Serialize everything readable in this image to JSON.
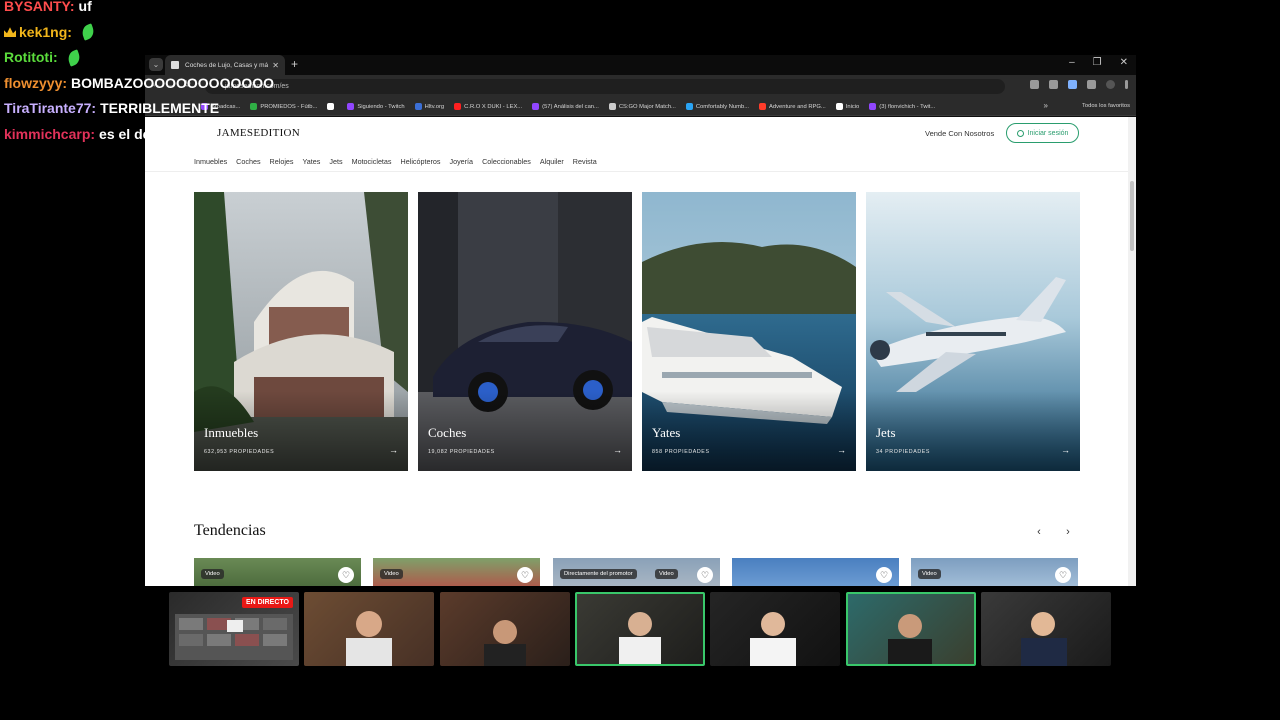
{
  "chat": {
    "messages": [
      {
        "user": "BYSANTY:",
        "text": "uf",
        "color": "#ff4d4d",
        "crown": false,
        "emote": false
      },
      {
        "user": "kek1ng:",
        "text": "",
        "color": "#f2b61b",
        "crown": true,
        "emote": true
      },
      {
        "user": "Rotitoti:",
        "text": "",
        "color": "#5bdc3c",
        "crown": false,
        "emote": true
      },
      {
        "user": "flowzyyy:",
        "text": "BOMBAZOOOOOOOOOOOOO",
        "color": "#f09030",
        "crown": false,
        "emote": false
      },
      {
        "user": "TiraTirante77:",
        "text": "TERRIBLEMENTE",
        "color": "#c8b0ff",
        "crown": false,
        "emote": false
      },
      {
        "user": "kimmichcarp:",
        "text": "es el de john wick",
        "color": "#e2325a",
        "crown": false,
        "emote": false
      }
    ]
  },
  "browser": {
    "tab_title": "Coches de Lujo, Casas y más - J",
    "url": "jamesedition.com/es",
    "bookmarks": [
      {
        "label": "Broadcas...",
        "color": "#9146ff"
      },
      {
        "label": "PROMIEDOS - Fútb...",
        "color": "#2fae45"
      },
      {
        "label": "",
        "color": "#ffffff"
      },
      {
        "label": "Siguiendo - Twitch",
        "color": "#9146ff"
      },
      {
        "label": "Hltv.org",
        "color": "#3b6fd6"
      },
      {
        "label": "C.R.O X DUKI - LEX...",
        "color": "#ff2020"
      },
      {
        "label": "(57) Análisis del can...",
        "color": "#9146ff"
      },
      {
        "label": "CS:GO Major Match...",
        "color": "#cccccc"
      },
      {
        "label": "Comfortably Numb...",
        "color": "#2aa4f4"
      },
      {
        "label": "Adventure and RPG...",
        "color": "#ff3c2a"
      },
      {
        "label": "Inicio",
        "color": "#ffffff"
      },
      {
        "label": "(3) flonvichich - Twit...",
        "color": "#9146ff"
      }
    ],
    "bookmarks_folder": "Todos los favoritos"
  },
  "site": {
    "logo": "JAMESEDITION",
    "sell_link": "Vende Con Nosotros",
    "login_button": "Iniciar sesión",
    "nav": [
      "Inmuebles",
      "Coches",
      "Relojes",
      "Yates",
      "Jets",
      "Motocicletas",
      "Helicópteros",
      "Joyería",
      "Coleccionables",
      "Alquiler",
      "Revista"
    ],
    "categories": [
      {
        "title": "Inmuebles",
        "count": "632,953 PROPIEDADES"
      },
      {
        "title": "Coches",
        "count": "19,082 PROPIEDADES"
      },
      {
        "title": "Yates",
        "count": "858 PROPIEDADES"
      },
      {
        "title": "Jets",
        "count": "34 PROPIEDADES"
      }
    ],
    "trends_title": "Tendencias",
    "trend_cards": [
      {
        "badges": [
          "Video"
        ]
      },
      {
        "badges": [
          "Video"
        ]
      },
      {
        "badges": [
          "Directamente del promotor",
          "Video"
        ]
      },
      {
        "badges": []
      },
      {
        "badges": [
          "Video"
        ]
      }
    ]
  },
  "stream": {
    "live_badge": "EN DIRECTO"
  }
}
